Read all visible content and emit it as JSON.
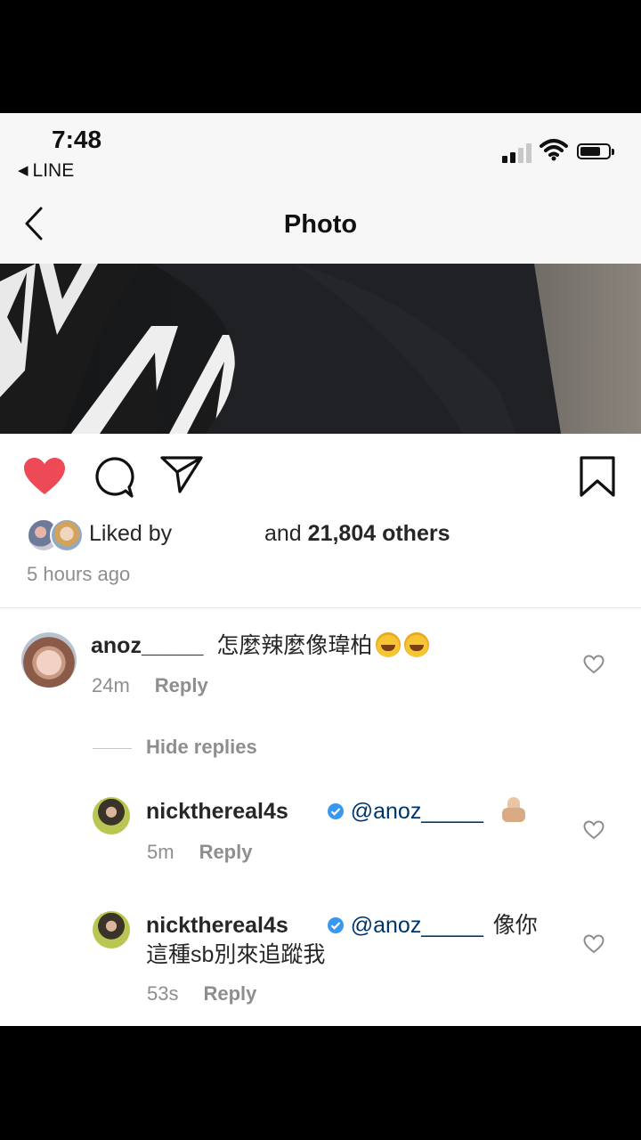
{
  "status": {
    "time": "7:48",
    "back_app": "LINE"
  },
  "nav": {
    "title": "Photo"
  },
  "post": {
    "liked_prefix": "Liked by",
    "liked_suffix_and": "and",
    "liked_count": "21,804 others",
    "time_ago": "5 hours ago"
  },
  "comments": [
    {
      "username": "anoz_____",
      "text": "怎麼辣麼像瑋柏",
      "time": "24m",
      "reply": "Reply"
    }
  ],
  "hide_replies": "Hide replies",
  "replies": [
    {
      "username": "nickthereal4s",
      "mention": "@anoz_____",
      "text": "",
      "time": "5m",
      "reply": "Reply"
    },
    {
      "username": "nickthereal4s",
      "mention": "@anoz_____",
      "text_line1": "像你",
      "text_line2": "這種sb別來追蹤我",
      "time": "53s",
      "reply": "Reply"
    }
  ],
  "colors": {
    "like_red": "#ed4956",
    "text": "#262626",
    "muted": "#8e8e8e",
    "verified_blue": "#3897f0"
  },
  "icons": [
    "back-icon",
    "heart-icon",
    "comment-icon",
    "share-icon",
    "bookmark-icon",
    "verified-icon",
    "heart-outline-icon"
  ]
}
